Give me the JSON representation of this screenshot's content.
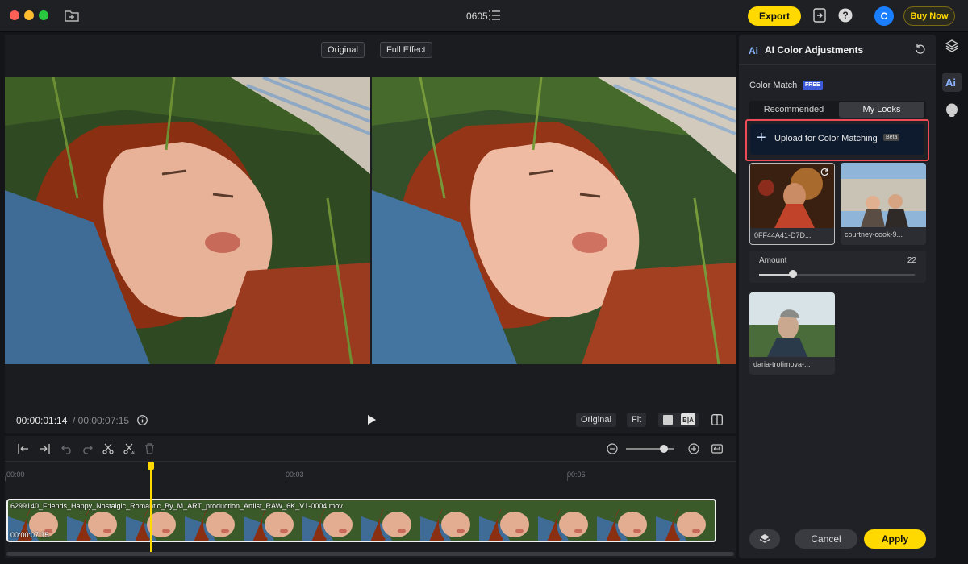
{
  "window": {
    "project_title": "0605",
    "export_label": "Export",
    "buy_label": "Buy Now",
    "avatar_initial": "C"
  },
  "preview": {
    "original_label": "Original",
    "full_effect_label": "Full Effect",
    "current_time": "00:00:01:14",
    "total_time": "/ 00:00:07:15",
    "controls": {
      "original_label": "Original",
      "fit_label": "Fit"
    }
  },
  "timeline": {
    "ruler_labels": [
      "00:00",
      "00:03",
      "00:06"
    ],
    "clip_name": "6299140_Friends_Happy_Nostalgic_Romantic_By_M_ART_production_Artlist_RAW_6K_V1-0004.mov",
    "clip_duration": "00:00:07:15"
  },
  "panel": {
    "title": "AI Color Adjustments",
    "section_label": "Color Match",
    "free_badge": "FREE",
    "tabs": [
      "Recommended",
      "My Looks"
    ],
    "active_tab": "My Looks",
    "upload_label": "Upload for Color Matching",
    "beta_label": "Beta",
    "looks": [
      {
        "label": "0FF44A41-D7D..."
      },
      {
        "label": "courtney-cook-9..."
      },
      {
        "label": "daria-trofimova-..."
      }
    ],
    "amount": {
      "label": "Amount",
      "value": "22"
    },
    "cancel_label": "Cancel",
    "apply_label": "Apply"
  },
  "colors": {
    "accent": "#ffd900",
    "highlight": "#ef4b57",
    "avatar": "#1a7fff"
  }
}
